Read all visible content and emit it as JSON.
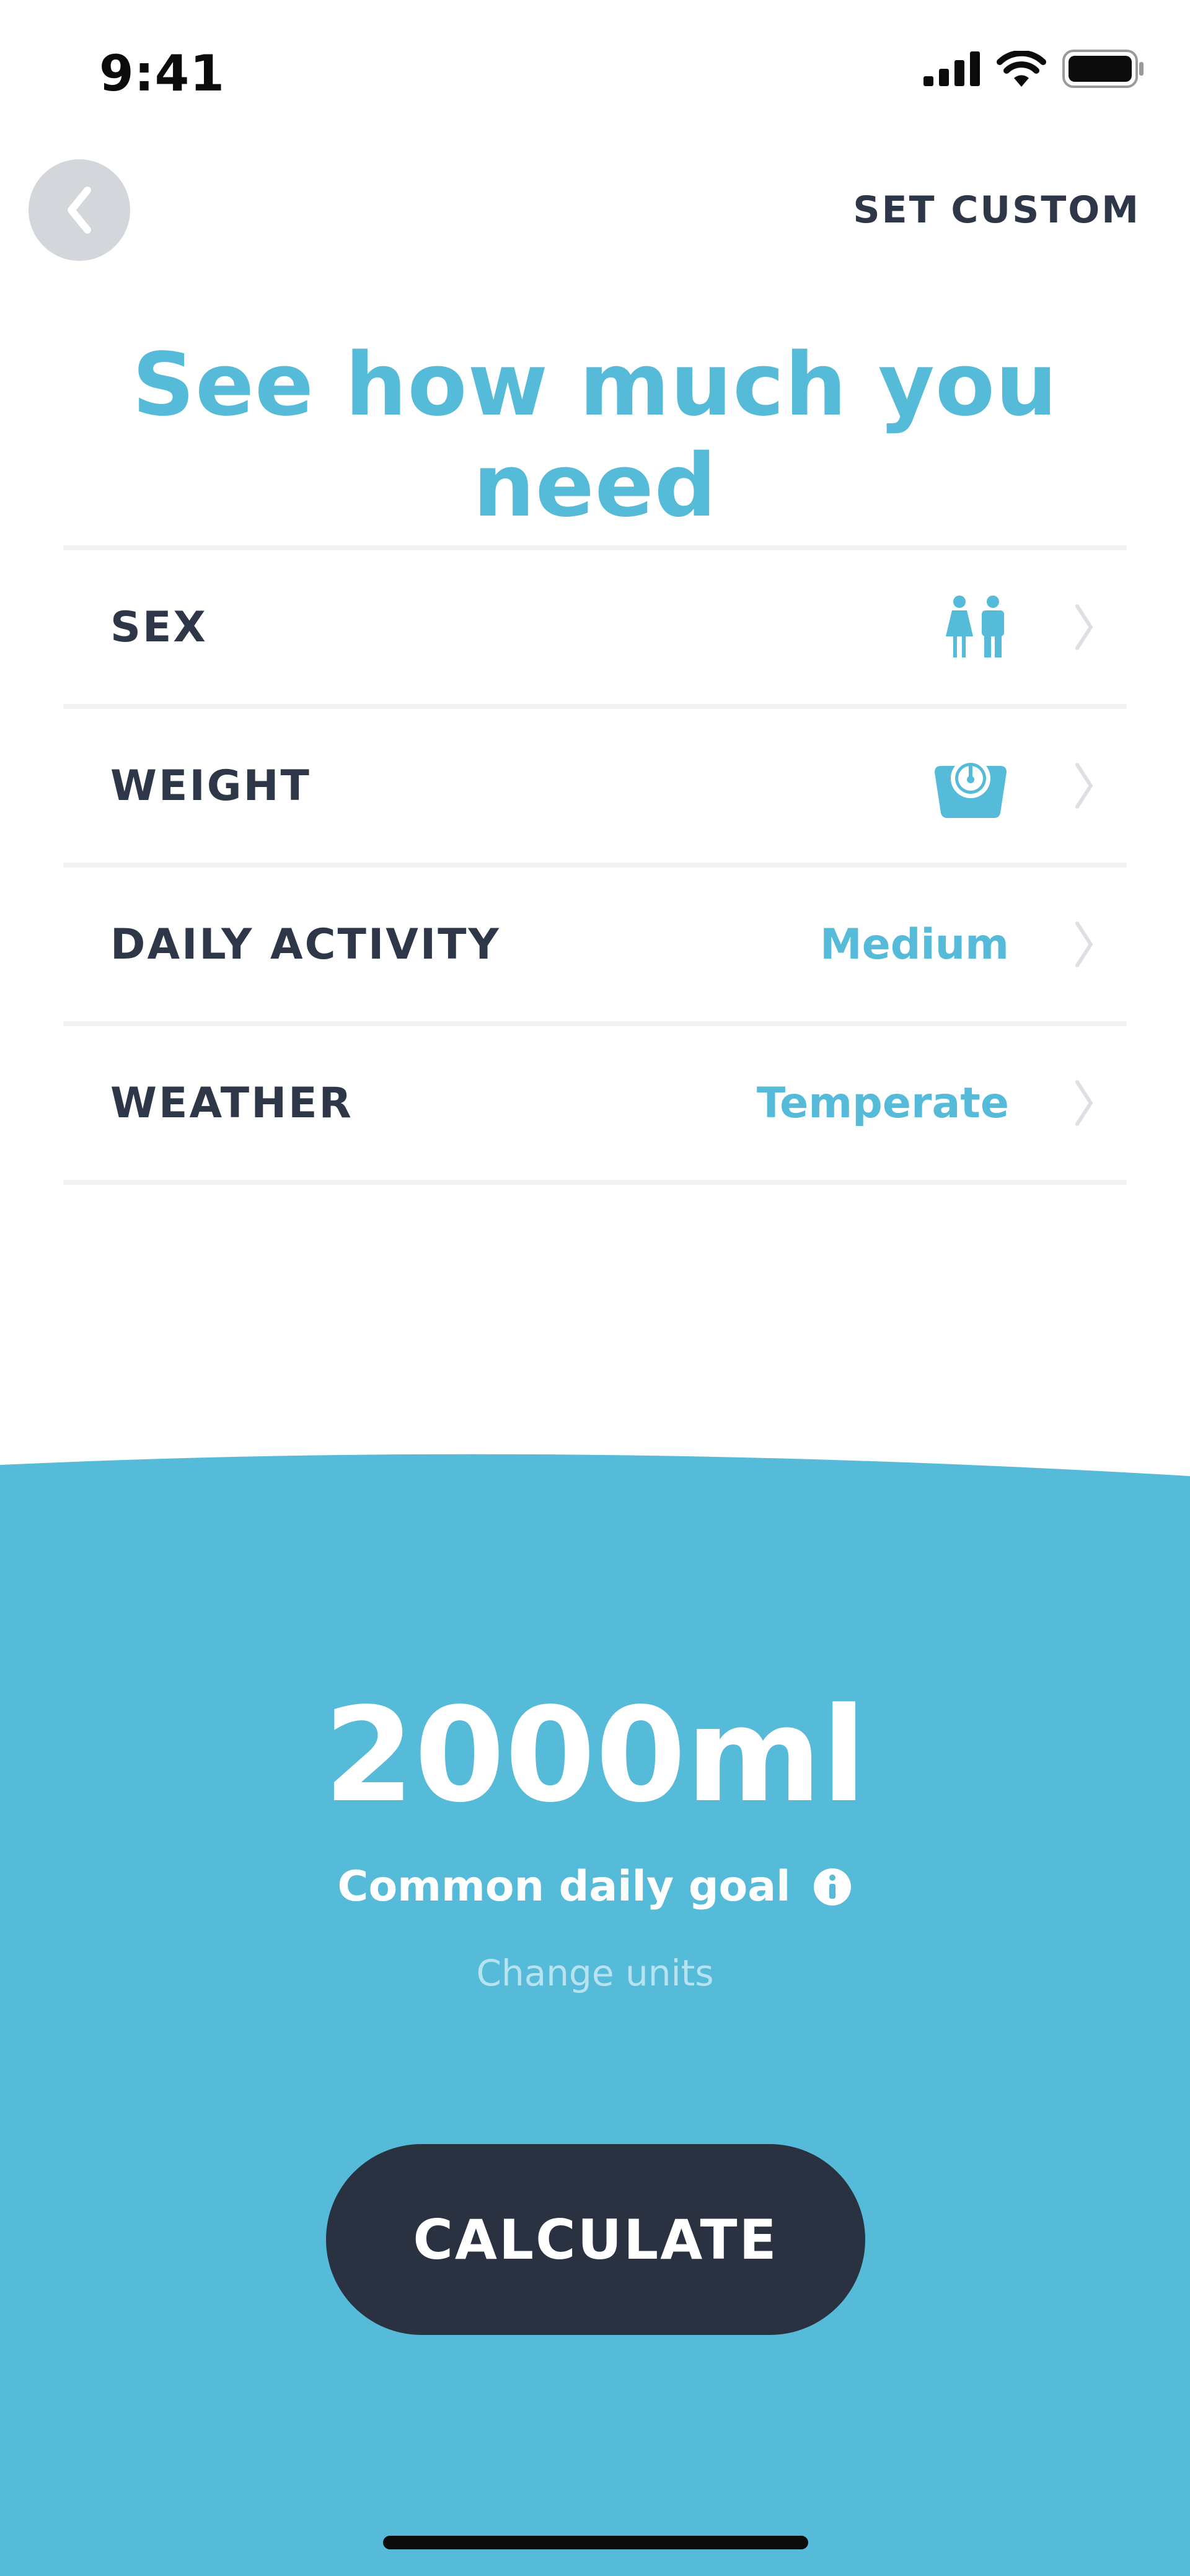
{
  "status_bar": {
    "time": "9:41"
  },
  "header": {
    "back_icon": "chevron-left-icon",
    "set_custom_label": "SET CUSTOM"
  },
  "title": "See how much you need",
  "settings": [
    {
      "label": "SEX",
      "icon": "male-female-icon"
    },
    {
      "label": "WEIGHT",
      "icon": "weighing-scale-icon"
    },
    {
      "label": "DAILY ACTIVITY",
      "value": "Medium"
    },
    {
      "label": "WEATHER",
      "value": "Temperate"
    }
  ],
  "goal": {
    "amount": "2000ml",
    "caption": "Common daily goal",
    "info_icon": "info-icon",
    "change_units_label": "Change units"
  },
  "calculate_label": "CALCULATE",
  "colors": {
    "accent": "#56bbd8",
    "dark": "#2e3748",
    "button": "#2a3140",
    "divider": "#f2f3f4"
  }
}
